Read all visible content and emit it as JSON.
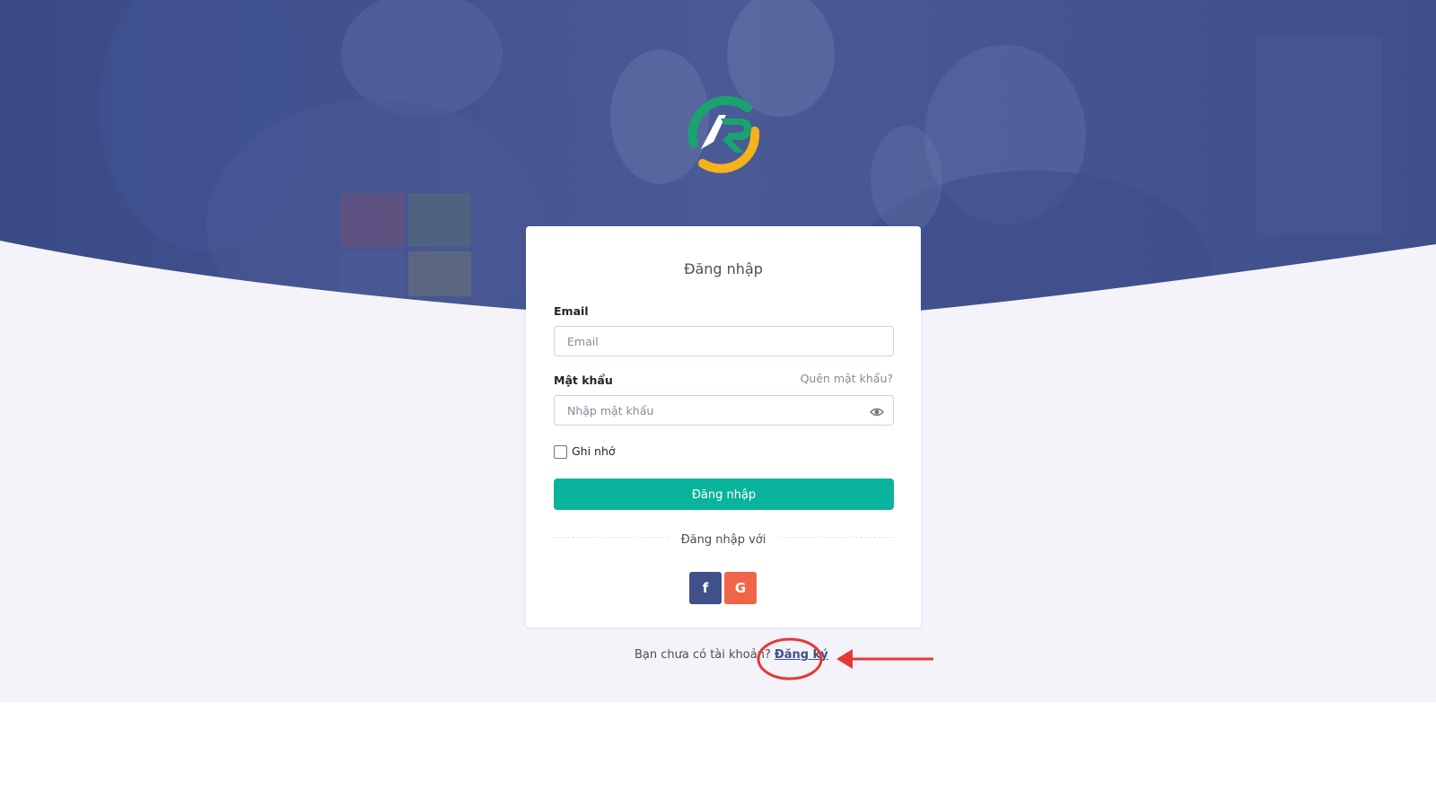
{
  "login": {
    "title": "Đăng nhập",
    "email_label": "Email",
    "email_placeholder": "Email",
    "email_value": "",
    "password_label": "Mật khẩu",
    "forgot_link": "Quên mật khẩu?",
    "password_placeholder": "Nhập mật khẩu",
    "password_value": "",
    "remember_label": "Ghi nhớ",
    "remember_checked": false,
    "submit_label": "Đăng nhập",
    "social_divider": "Đăng nhập với",
    "facebook_glyph": "f",
    "google_glyph": "G"
  },
  "signup": {
    "prompt": "Bạn chưa có tài khoản?",
    "link": "Đăng ký"
  },
  "colors": {
    "primary": "#405189",
    "success": "#0ab39c",
    "danger": "#f06548",
    "annotation": "#e53935",
    "logo_green": "#1aa36f",
    "logo_orange": "#f6b21b",
    "page_bg": "#f3f3f9"
  },
  "icons": {
    "logo": "ar-logo",
    "password_toggle": "eye-icon",
    "facebook": "facebook-icon",
    "google": "google-icon",
    "annotation_arrow": "arrow-left-icon",
    "annotation_circle": "highlight-circle"
  }
}
